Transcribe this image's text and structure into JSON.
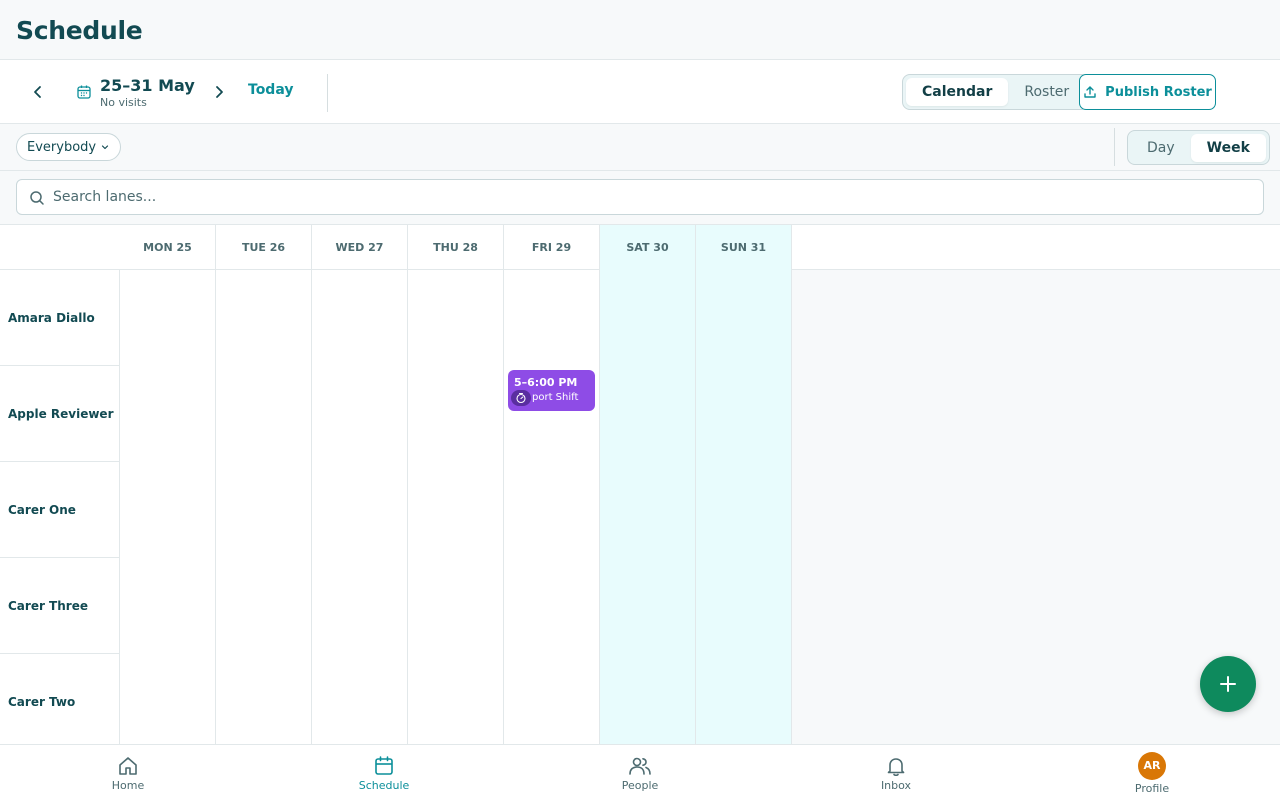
{
  "page": {
    "title": "Schedule"
  },
  "toolbar": {
    "date_range": "25–31 May",
    "visits_summary": "No visits",
    "today_label": "Today",
    "view_tabs": [
      {
        "label": "Calendar",
        "active": true
      },
      {
        "label": "Roster",
        "active": false
      }
    ],
    "publish_label": "Publish Roster"
  },
  "filter": {
    "everybody_label": "Everybody",
    "range_tabs": [
      {
        "label": "Day",
        "active": false
      },
      {
        "label": "Week",
        "active": true
      }
    ]
  },
  "search": {
    "placeholder": "Search lanes..."
  },
  "grid": {
    "days": [
      {
        "label": "MON 25",
        "weekend": false
      },
      {
        "label": "TUE 26",
        "weekend": false
      },
      {
        "label": "WED 27",
        "weekend": false
      },
      {
        "label": "THU 28",
        "weekend": false
      },
      {
        "label": "FRI 29",
        "weekend": false
      },
      {
        "label": "SAT 30",
        "weekend": true
      },
      {
        "label": "SUN 31",
        "weekend": true
      }
    ],
    "lanes": [
      {
        "name": "Amara Diallo"
      },
      {
        "name": "Apple Reviewer"
      },
      {
        "name": "Carer One"
      },
      {
        "name": "Carer Three"
      },
      {
        "name": "Carer Two"
      }
    ],
    "shift": {
      "time": "5–6:00 PM",
      "label": "port Shift",
      "lane": "Apple Reviewer",
      "day": "FRI 29",
      "color": "#8e4ce6"
    }
  },
  "colors": {
    "accent": "#0c8f9a",
    "title": "#124a52",
    "fab": "#0e8a5d",
    "weekend_bg": "#e8fcfd",
    "avatar": "#d97706"
  },
  "bottom_nav": [
    {
      "label": "Home",
      "icon": "home-icon",
      "active": false
    },
    {
      "label": "Schedule",
      "icon": "calendar-icon",
      "active": true
    },
    {
      "label": "People",
      "icon": "people-icon",
      "active": false
    },
    {
      "label": "Inbox",
      "icon": "bell-icon",
      "active": false
    },
    {
      "label": "Profile",
      "icon": "avatar",
      "active": false,
      "initials": "AR"
    }
  ]
}
